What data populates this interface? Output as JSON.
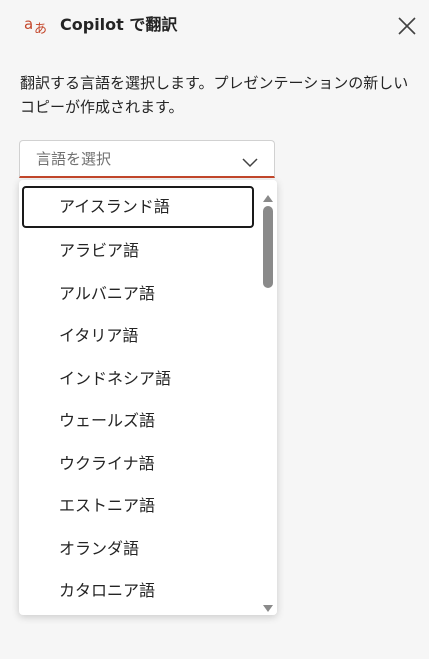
{
  "header": {
    "title": "Copilot で翻訳",
    "logo_icon": "translate-icon",
    "close_icon": "close-icon",
    "accent_color": "#c4472b"
  },
  "description": "翻訳する言語を選択します。プレゼンテーションの新しいコピーが作成されます。",
  "language_select": {
    "placeholder": "言語を選択",
    "chevron_icon": "chevron-down-icon",
    "options": [
      "アイスランド語",
      "アラビア語",
      "アルバニア語",
      "イタリア語",
      "インドネシア語",
      "ウェールズ語",
      "ウクライナ語",
      "エストニア語",
      "オランダ語",
      "カタロニア語"
    ]
  }
}
